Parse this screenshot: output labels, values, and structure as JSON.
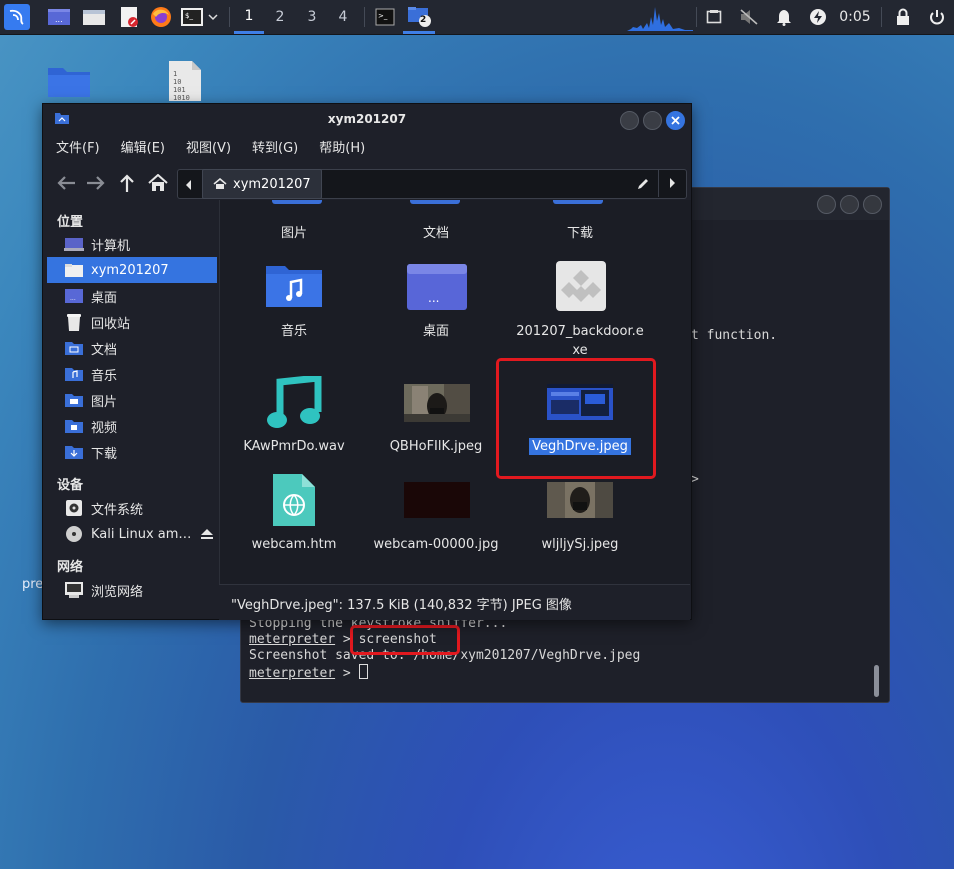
{
  "taskbar": {
    "workspaces": [
      "1",
      "2",
      "3",
      "4"
    ],
    "active_workspace": "1",
    "window_badge": "2",
    "clock": "0:05"
  },
  "file_manager": {
    "title": "xym201207",
    "menu": [
      "文件(F)",
      "编辑(E)",
      "视图(V)",
      "转到(G)",
      "帮助(H)"
    ],
    "path_crumb": "xym201207",
    "sidebar": {
      "places_header": "位置",
      "places": [
        "计算机",
        "xym201207",
        "桌面",
        "回收站",
        "文档",
        "音乐",
        "图片",
        "视频",
        "下载"
      ],
      "devices_header": "设备",
      "devices": [
        "文件系统",
        "Kali Linux am…"
      ],
      "network_header": "网络",
      "network": [
        "浏览网络"
      ]
    },
    "files": {
      "row0": [
        "图片",
        "文档",
        "下载"
      ],
      "music": "音乐",
      "desktop": "桌面",
      "exe_line1": "201207_backdoor.e",
      "exe_line2": "xe",
      "wav": "KAwPmrDo.wav",
      "qbh": "QBHoFIlK.jpeg",
      "vegh": "VeghDrve.jpeg",
      "htm": "webcam.htm",
      "webcam": "webcam-00000.jpg",
      "wlj": "wljljySj.jpeg"
    },
    "status": "\"VeghDrve.jpeg\": 137.5 KiB (140,832 字节) JPEG 图像"
  },
  "terminal": {
    "partial_right": "t function.",
    "gt": ">",
    "line1": "Stopping the keystroke sniffer...",
    "prompt": "meterpreter",
    "prompt_sep": " > ",
    "cmd": "screenshot",
    "line3": "Screenshot saved to: /home/xym201207/VeghDrve.jpeg"
  },
  "desktop": {
    "pre_text": "pre"
  },
  "colors": {
    "accent": "#3574e0",
    "highlight_box": "#e2191f",
    "folder": "#3a6fd8"
  }
}
